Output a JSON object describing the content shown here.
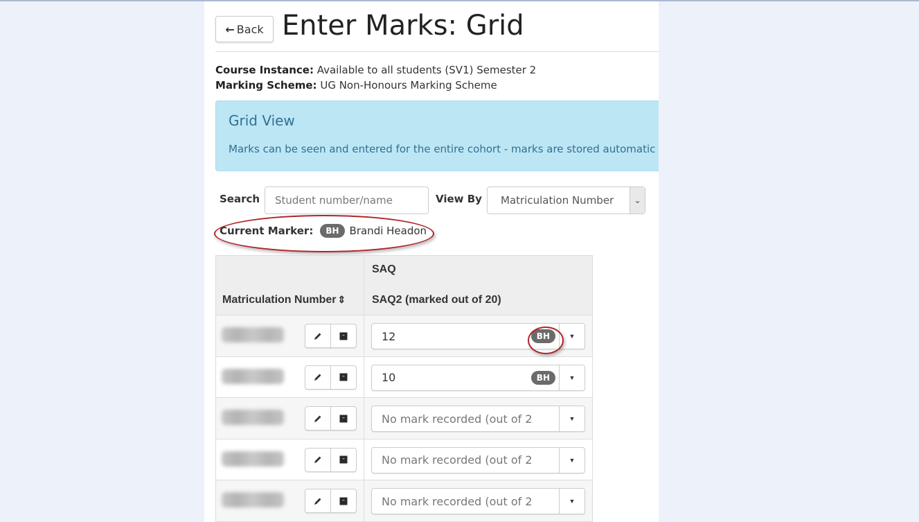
{
  "header": {
    "back_label": "Back",
    "title": "Enter Marks: Grid"
  },
  "meta": {
    "course_instance_label": "Course Instance:",
    "course_instance_value": "Available to all students (SV1) Semester 2",
    "marking_scheme_label": "Marking Scheme:",
    "marking_scheme_value": "UG Non-Honours Marking Scheme"
  },
  "alert": {
    "title": "Grid View",
    "text": "Marks can be seen and entered for the entire cohort - marks are stored automatic"
  },
  "filters": {
    "search_label": "Search",
    "search_placeholder": "Student number/name",
    "search_value": "",
    "view_by_label": "View By",
    "view_by_value": "Matriculation Number"
  },
  "current_marker": {
    "label": "Current Marker:",
    "initials": "BH",
    "name": "Brandi Headon"
  },
  "table": {
    "columns": {
      "matric": "Matriculation Number",
      "group": "SAQ",
      "question": "SAQ2 (marked out of 20)"
    },
    "rows": [
      {
        "mark": "12",
        "marker": "BH",
        "placeholder": ""
      },
      {
        "mark": "10",
        "marker": "BH",
        "placeholder": ""
      },
      {
        "mark": "",
        "marker": "",
        "placeholder": "No mark recorded (out of 2"
      },
      {
        "mark": "",
        "marker": "",
        "placeholder": "No mark recorded (out of 2"
      },
      {
        "mark": "",
        "marker": "",
        "placeholder": "No mark recorded (out of 2"
      }
    ]
  },
  "icons": {
    "back": "arrow-left-icon",
    "sort": "sort-icon",
    "edit": "pencil-icon",
    "archive": "archive-icon",
    "dropdown": "caret-down-icon",
    "select": "chevron-down-icon"
  },
  "colors": {
    "alert_bg": "#bde6f5",
    "alert_text": "#31708f",
    "badge_bg": "#6b6b6b",
    "annotation_red": "#b0232a",
    "page_bg": "#edf1fa"
  }
}
